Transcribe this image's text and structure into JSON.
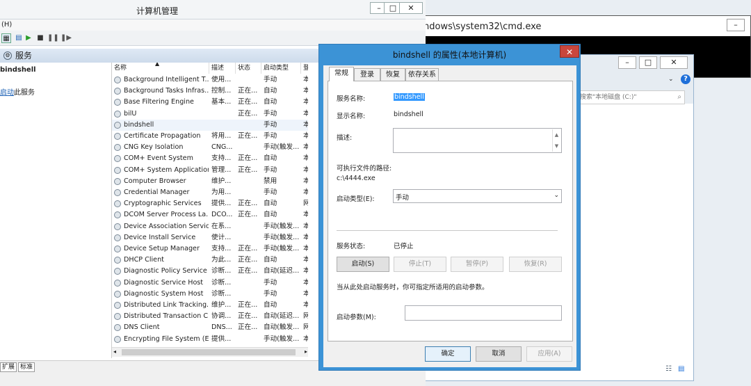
{
  "cmd": {
    "title": "ndows\\system32\\cmd.exe"
  },
  "explorer": {
    "search_placeholder": "搜索\"本地磁盘 (C:)\""
  },
  "mmc": {
    "title": "计算机管理",
    "menu": "(H)",
    "pane_title": "服务",
    "selected_service": "bindshell",
    "start_link": "启动",
    "start_suffix": "此服务",
    "tabs": [
      "扩展",
      "标准"
    ],
    "columns": [
      "名称",
      "描述",
      "状态",
      "启动类型",
      "登"
    ],
    "services": [
      {
        "name": "Background Intelligent T...",
        "desc": "使用...",
        "status": "",
        "startup": "手动",
        "logon": "本"
      },
      {
        "name": "Background Tasks Infras...",
        "desc": "控制...",
        "status": "正在...",
        "startup": "自动",
        "logon": "本"
      },
      {
        "name": "Base Filtering Engine",
        "desc": "基本...",
        "status": "正在...",
        "startup": "自动",
        "logon": "本"
      },
      {
        "name": "bilU",
        "desc": "",
        "status": "正在...",
        "startup": "手动",
        "logon": "本"
      },
      {
        "name": "bindshell",
        "desc": "",
        "status": "",
        "startup": "手动",
        "logon": "本"
      },
      {
        "name": "Certificate Propagation",
        "desc": "将用...",
        "status": "正在...",
        "startup": "手动",
        "logon": "本"
      },
      {
        "name": "CNG Key Isolation",
        "desc": "CNG...",
        "status": "",
        "startup": "手动(触发...",
        "logon": "本"
      },
      {
        "name": "COM+ Event System",
        "desc": "支持...",
        "status": "正在...",
        "startup": "自动",
        "logon": "本"
      },
      {
        "name": "COM+ System Application",
        "desc": "管理...",
        "status": "正在...",
        "startup": "手动",
        "logon": "本"
      },
      {
        "name": "Computer Browser",
        "desc": "维护...",
        "status": "",
        "startup": "禁用",
        "logon": "本"
      },
      {
        "name": "Credential Manager",
        "desc": "为用...",
        "status": "",
        "startup": "手动",
        "logon": "本"
      },
      {
        "name": "Cryptographic Services",
        "desc": "提供...",
        "status": "正在...",
        "startup": "自动",
        "logon": "网"
      },
      {
        "name": "DCOM Server Process La...",
        "desc": "DCO...",
        "status": "正在...",
        "startup": "自动",
        "logon": "本"
      },
      {
        "name": "Device Association Service",
        "desc": "在系...",
        "status": "",
        "startup": "手动(触发...",
        "logon": "本"
      },
      {
        "name": "Device Install Service",
        "desc": "使计...",
        "status": "",
        "startup": "手动(触发...",
        "logon": "本"
      },
      {
        "name": "Device Setup Manager",
        "desc": "支持...",
        "status": "正在...",
        "startup": "手动(触发...",
        "logon": "本"
      },
      {
        "name": "DHCP Client",
        "desc": "为此...",
        "status": "正在...",
        "startup": "自动",
        "logon": "本"
      },
      {
        "name": "Diagnostic Policy Service",
        "desc": "诊断...",
        "status": "正在...",
        "startup": "自动(延迟...",
        "logon": "本"
      },
      {
        "name": "Diagnostic Service Host",
        "desc": "诊断...",
        "status": "",
        "startup": "手动",
        "logon": "本"
      },
      {
        "name": "Diagnostic System Host",
        "desc": "诊断...",
        "status": "",
        "startup": "手动",
        "logon": "本"
      },
      {
        "name": "Distributed Link Tracking...",
        "desc": "维护...",
        "status": "正在...",
        "startup": "自动",
        "logon": "本"
      },
      {
        "name": "Distributed Transaction C...",
        "desc": "协调...",
        "status": "正在...",
        "startup": "自动(延迟...",
        "logon": "网"
      },
      {
        "name": "DNS Client",
        "desc": "DNS...",
        "status": "正在...",
        "startup": "自动(触发...",
        "logon": "网"
      },
      {
        "name": "Encrypting File System (E...",
        "desc": "提供...",
        "status": "",
        "startup": "手动(触发...",
        "logon": "本"
      }
    ]
  },
  "dialog": {
    "title": "bindshell 的属性(本地计算机)",
    "tabs": [
      "常规",
      "登录",
      "恢复",
      "依存关系"
    ],
    "service_name_label": "服务名称:",
    "service_name": "bindshell",
    "display_name_label": "显示名称:",
    "display_name": "bindshell",
    "description_label": "描述:",
    "exe_path_label": "可执行文件的路径:",
    "exe_path": "c:\\4444.exe",
    "startup_type_label": "启动类型(E):",
    "startup_type": "手动",
    "status_label": "服务状态:",
    "status": "已停止",
    "btn_start": "启动(S)",
    "btn_stop": "停止(T)",
    "btn_pause": "暂停(P)",
    "btn_resume": "恢复(R)",
    "hint": "当从此处启动服务时，你可指定所适用的启动参数。",
    "params_label": "启动参数(M):",
    "ok": "确定",
    "cancel": "取消",
    "apply": "应用(A)"
  }
}
